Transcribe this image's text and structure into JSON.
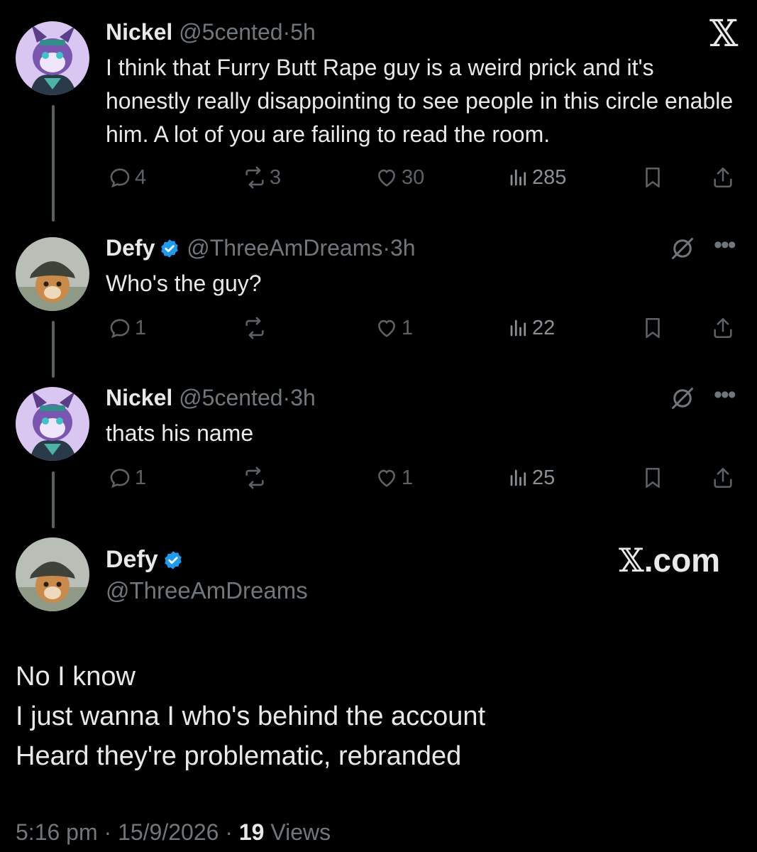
{
  "colors": {
    "background": "#000000",
    "text": "#e7e9ea",
    "muted": "#71767b",
    "verified": "#1d9bf0"
  },
  "brand": {
    "logo_icon": "x-logo-icon",
    "watermark_x": "𝕏",
    "watermark_domain": ".com"
  },
  "tweets": [
    {
      "name": "Nickel",
      "handle": "@5cented",
      "sep": "·",
      "time": "5h",
      "verified": false,
      "text": "I think that Furry Butt Rape guy is a weird prick and it's honestly really disappointing to see people in this circle enable him. A lot of you are failing to read the room.",
      "replies": "4",
      "reposts": "3",
      "likes": "30",
      "views": "285"
    },
    {
      "name": "Defy",
      "handle": "@ThreeAmDreams",
      "sep": "·",
      "time": "3h",
      "verified": true,
      "text": "Who's the guy?",
      "replies": "1",
      "reposts": "",
      "likes": "1",
      "views": "22"
    },
    {
      "name": "Nickel",
      "handle": "@5cented",
      "sep": "·",
      "time": "3h",
      "verified": false,
      "text": "thats his name",
      "replies": "1",
      "reposts": "",
      "likes": "1",
      "views": "25"
    }
  ],
  "main_tweet": {
    "name": "Defy",
    "handle": "@ThreeAmDreams",
    "lines": [
      "No I know",
      "I just wanna I who's behind the account",
      "Heard they're problematic, rebranded"
    ],
    "time": "5:16 pm",
    "sep": "·",
    "date": "15/9/2026",
    "views_count": "19",
    "views_label": "Views"
  }
}
